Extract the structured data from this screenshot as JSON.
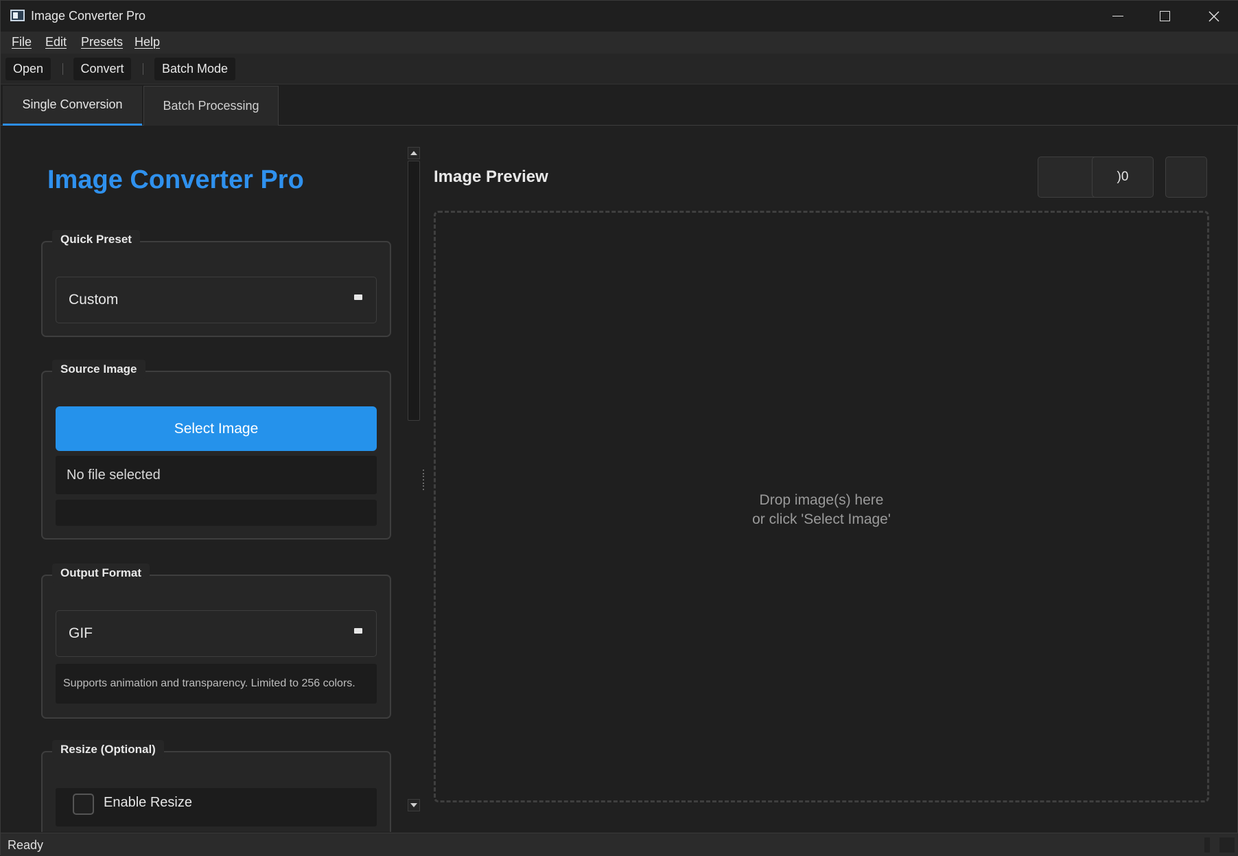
{
  "window": {
    "title": "Image Converter Pro"
  },
  "menu": {
    "items": [
      "File",
      "Edit",
      "Presets",
      "Help"
    ]
  },
  "toolbar": {
    "open_label": "Open",
    "convert_label": "Convert",
    "batch_label": "Batch Mode"
  },
  "tabs": [
    {
      "label": "Single Conversion",
      "active": true
    },
    {
      "label": "Batch Processing",
      "active": false
    }
  ],
  "left": {
    "heading": "Image Converter Pro",
    "quick_preset": {
      "label": "Quick Preset",
      "value": "Custom"
    },
    "source_image": {
      "label": "Source Image",
      "select_button": "Select Image",
      "file_text": "No file selected",
      "info_text": ""
    },
    "output_format": {
      "label": "Output Format",
      "value": "GIF",
      "description": "Supports animation and transparency. Limited to 256 colors."
    },
    "resize": {
      "label": "Resize (Optional)",
      "enable_label": "Enable Resize",
      "enabled": false
    }
  },
  "preview": {
    "title": "Image Preview",
    "zoom_text": ")0",
    "drop_line1": "Drop image(s) here",
    "drop_line2": "or click 'Select Image'"
  },
  "status": {
    "text": "Ready"
  },
  "colors": {
    "accent": "#2592eb",
    "heading": "#2f91ee",
    "background": "#202020"
  }
}
